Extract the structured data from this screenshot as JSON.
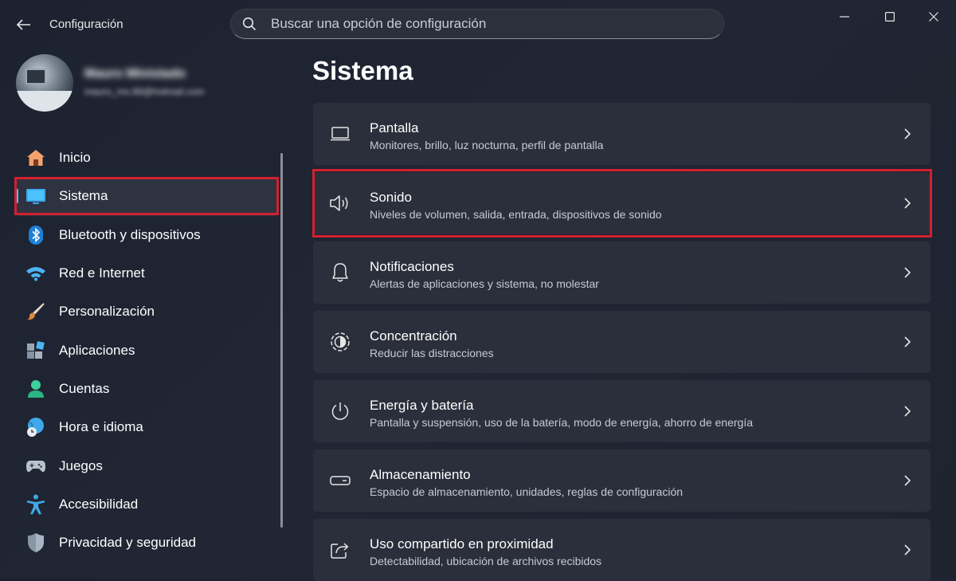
{
  "window": {
    "title": "Configuración",
    "search_placeholder": "Buscar una opción de configuración",
    "controls": [
      "minimize-icon",
      "maximize-icon",
      "close-icon"
    ]
  },
  "profile": {
    "name": "Mauro Ministado",
    "email": "mauro_ms.88@hotmail.com"
  },
  "sidebar": {
    "selected": "Sistema",
    "items": [
      {
        "label": "Inicio",
        "icon": "home-icon"
      },
      {
        "label": "Sistema",
        "icon": "system-monitor-icon"
      },
      {
        "label": "Bluetooth y dispositivos",
        "icon": "bluetooth-icon"
      },
      {
        "label": "Red e Internet",
        "icon": "wifi-icon"
      },
      {
        "label": "Personalización",
        "icon": "brush-icon"
      },
      {
        "label": "Aplicaciones",
        "icon": "apps-icon"
      },
      {
        "label": "Cuentas",
        "icon": "account-icon"
      },
      {
        "label": "Hora e idioma",
        "icon": "globe-clock-icon"
      },
      {
        "label": "Juegos",
        "icon": "gamepad-icon"
      },
      {
        "label": "Accesibilidad",
        "icon": "accessibility-icon"
      },
      {
        "label": "Privacidad y seguridad",
        "icon": "shield-icon"
      }
    ]
  },
  "main": {
    "title": "Sistema",
    "cards": [
      {
        "title": "Pantalla",
        "subtitle": "Monitores, brillo, luz nocturna, perfil de pantalla",
        "icon": "display-icon"
      },
      {
        "title": "Sonido",
        "subtitle": "Niveles de volumen, salida, entrada, dispositivos de sonido",
        "icon": "speaker-icon"
      },
      {
        "title": "Notificaciones",
        "subtitle": "Alertas de aplicaciones y sistema, no molestar",
        "icon": "bell-icon"
      },
      {
        "title": "Concentración",
        "subtitle": "Reducir las distracciones",
        "icon": "focus-icon"
      },
      {
        "title": "Energía y batería",
        "subtitle": "Pantalla y suspensión, uso de la batería, modo de energía, ahorro de energía",
        "icon": "power-icon"
      },
      {
        "title": "Almacenamiento",
        "subtitle": "Espacio de almacenamiento, unidades, reglas de configuración",
        "icon": "storage-icon"
      },
      {
        "title": "Uso compartido en proximidad",
        "subtitle": "Detectabilidad, ubicación de archivos recibidos",
        "icon": "share-icon"
      }
    ]
  },
  "colors": {
    "accent": "#4cc2ff",
    "highlight": "#d2202f",
    "card_bg": "#2b2f3b",
    "window_bg": "#1f2431"
  }
}
